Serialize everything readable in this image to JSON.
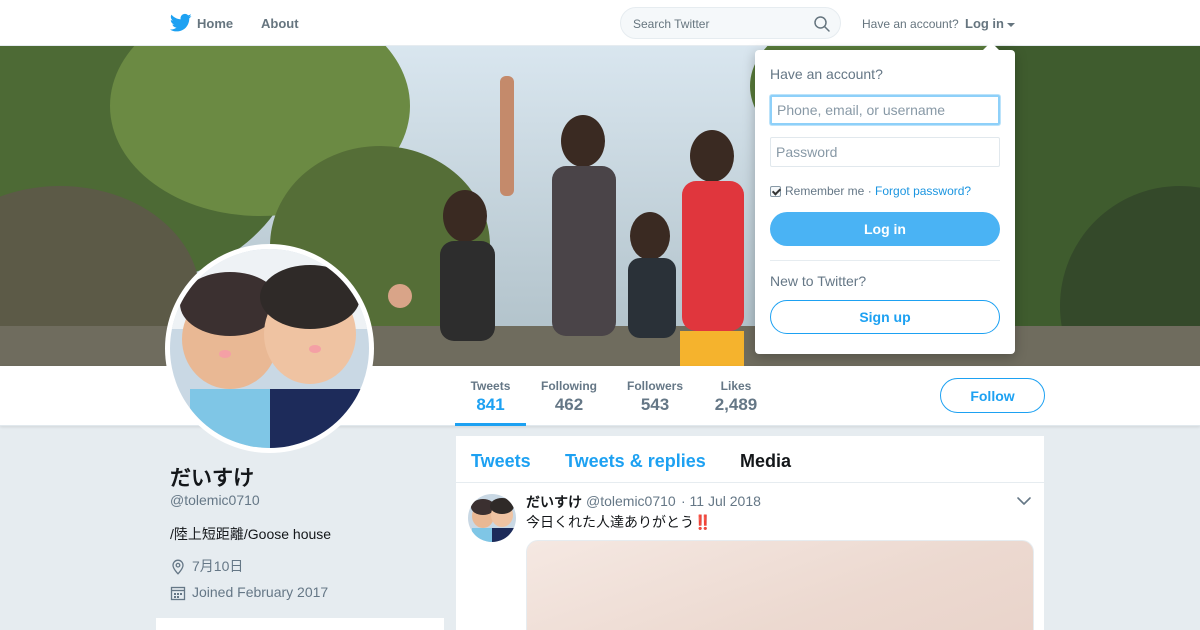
{
  "nav": {
    "home_label": "Home",
    "about_label": "About",
    "search_placeholder": "Search Twitter",
    "have_account": "Have an account?",
    "login_label": "Log in"
  },
  "profile": {
    "name": "だいすけ",
    "handle": "@tolemic0710",
    "bio": "/陸上短距離/Goose house",
    "location": "7月10日",
    "joined": "Joined February 2017",
    "follow_label": "Follow"
  },
  "stats": [
    {
      "label": "Tweets",
      "value": "841",
      "active": true
    },
    {
      "label": "Following",
      "value": "462",
      "active": false
    },
    {
      "label": "Followers",
      "value": "543",
      "active": false
    },
    {
      "label": "Likes",
      "value": "2,489",
      "active": false
    }
  ],
  "timeline": {
    "tabs": [
      "Tweets",
      "Tweets & replies",
      "Media"
    ],
    "selected_tab": "Media",
    "tweet": {
      "name": "だいすけ",
      "handle": "@tolemic0710",
      "time": "· 11 Jul 2018",
      "text": "今日くれた人達ありがとう",
      "emphasis": "‼️"
    }
  },
  "login_dropdown": {
    "title": "Have an account?",
    "username_placeholder": "Phone, email, or username",
    "password_placeholder": "Password",
    "remember_label": "Remember me",
    "separator": "·",
    "forgot_label": "Forgot password?",
    "login_button": "Log in",
    "new_to": "New to Twitter?",
    "signup_button": "Sign up"
  },
  "colors": {
    "accent": "#1da1f2",
    "page_bg": "#e6ecf0",
    "text_secondary": "#657786"
  },
  "icons": [
    "twitter-bird-icon",
    "search-icon",
    "location-pin-icon",
    "calendar-icon",
    "chevron-down-icon"
  ]
}
